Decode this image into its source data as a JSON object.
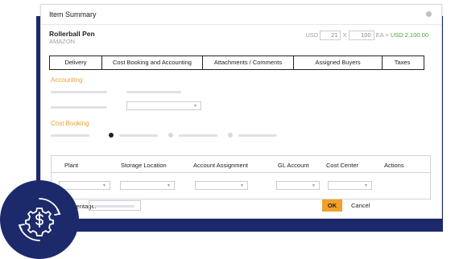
{
  "dialog": {
    "title": "Item Summary",
    "close_icon": "close-icon",
    "item_name": "Rollerball Pen",
    "vendor": "AMAZON",
    "currency": "USD",
    "unit_price": "21",
    "times": "X",
    "quantity": "100",
    "uom_equals": "EA =",
    "total": "USD 2,100.00"
  },
  "tabs": [
    {
      "label": "Delivery"
    },
    {
      "label": "Cost Booking and Accounting"
    },
    {
      "label": "Attachments / Comments"
    },
    {
      "label": "Assigned Buyers"
    },
    {
      "label": "Taxes"
    }
  ],
  "sections": {
    "accounting": "Accounting",
    "cost_booking": "Cost Booking"
  },
  "table": {
    "headers": [
      "Plant",
      "Storage Location",
      "Account Assignment",
      "GL Account",
      "Cost Center",
      "Actions"
    ]
  },
  "footer": {
    "percentage_label": "ning Percentage:",
    "ok": "OK",
    "cancel": "Cancel"
  },
  "colors": {
    "accent_orange": "#f0a030",
    "navy": "#1c2a6b",
    "total_green": "#4aa832"
  },
  "badge": {
    "icon": "dollar-cog-cycle-icon"
  }
}
